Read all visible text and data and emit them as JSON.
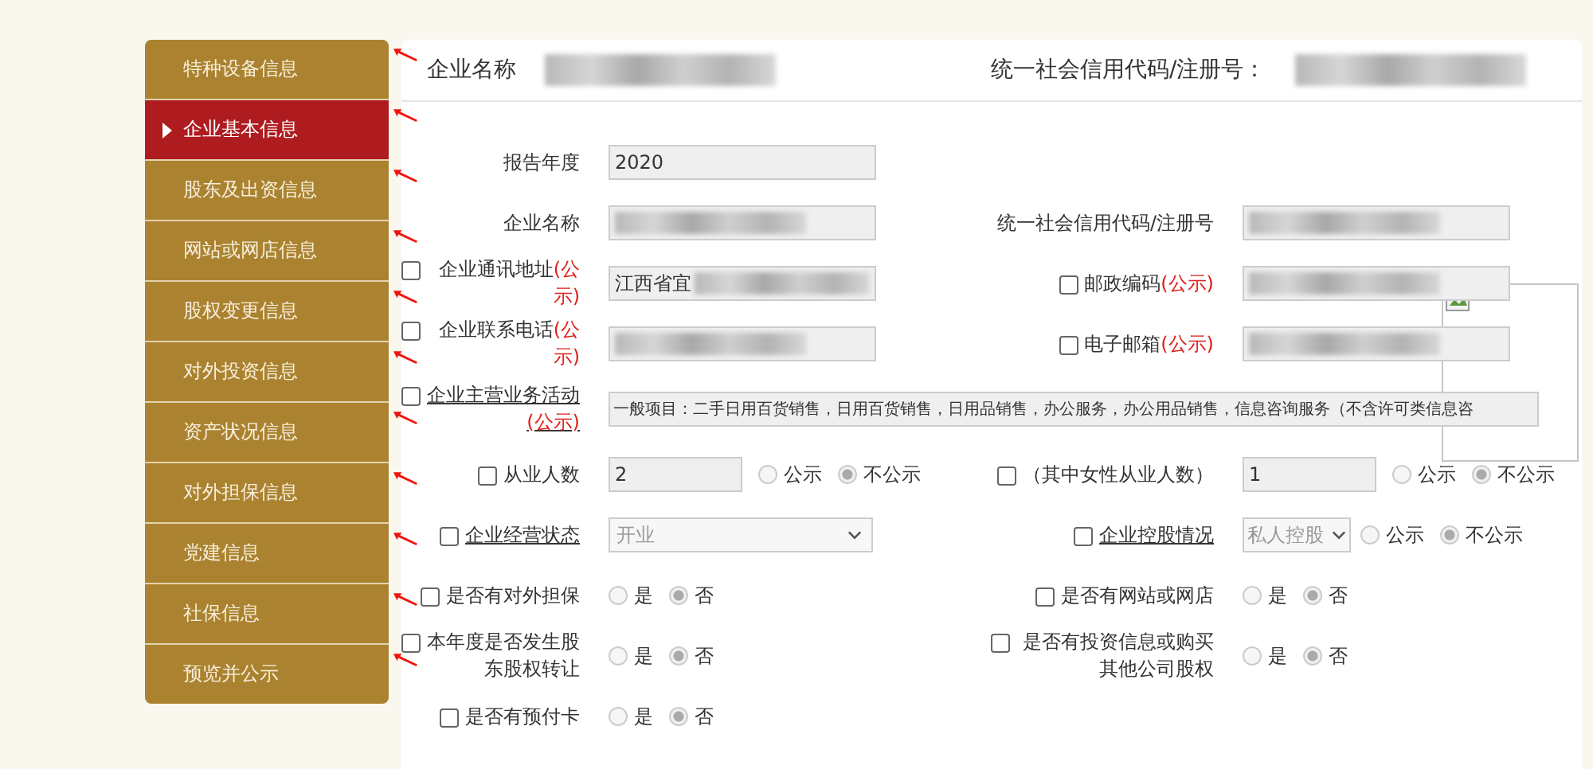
{
  "sidebar": {
    "items": [
      {
        "label": "特种设备信息",
        "selected": false,
        "annotated": true
      },
      {
        "label": "企业基本信息",
        "selected": true,
        "annotated": true
      },
      {
        "label": "股东及出资信息",
        "selected": false,
        "annotated": true
      },
      {
        "label": "网站或网店信息",
        "selected": false,
        "annotated": true
      },
      {
        "label": "股权变更信息",
        "selected": false,
        "annotated": true
      },
      {
        "label": "对外投资信息",
        "selected": false,
        "annotated": true
      },
      {
        "label": "资产状况信息",
        "selected": false,
        "annotated": true
      },
      {
        "label": "对外担保信息",
        "selected": false,
        "annotated": true
      },
      {
        "label": "党建信息",
        "selected": false,
        "annotated": true
      },
      {
        "label": "社保信息",
        "selected": false,
        "annotated": true
      },
      {
        "label": "预览并公示",
        "selected": false,
        "annotated": true
      }
    ]
  },
  "header": {
    "company_label": "企业名称",
    "code_label": "统一社会信用代码/注册号："
  },
  "form": {
    "rows": [
      {
        "fields": [
          {
            "label": "报告年度",
            "underlined": false,
            "control": {
              "kind": "input",
              "value": "2020"
            }
          }
        ]
      },
      {
        "fields": [
          {
            "label": "企业名称",
            "underlined": false,
            "control": {
              "kind": "input",
              "redacted": true
            }
          },
          {
            "label": "统一社会信用代码/注册号",
            "underlined": false,
            "control": {
              "kind": "input",
              "redacted": true
            }
          }
        ]
      },
      {
        "fields": [
          {
            "label": "企业通讯地址",
            "note": "(公示)",
            "checked": false,
            "underlined": false,
            "control": {
              "kind": "input",
              "value": "江西省宜",
              "redacted": true
            }
          },
          {
            "label": "邮政编码",
            "note": "(公示)",
            "checked": false,
            "underlined": false,
            "control": {
              "kind": "input",
              "redacted": true
            }
          }
        ]
      },
      {
        "fields": [
          {
            "label": "企业联系电话",
            "note": "(公示)",
            "checked": false,
            "underlined": false,
            "control": {
              "kind": "input",
              "redacted": true
            }
          },
          {
            "label": "电子邮箱",
            "note": "(公示)",
            "checked": false,
            "underlined": false,
            "control": {
              "kind": "input",
              "redacted": true
            }
          }
        ]
      },
      {
        "fields": [
          {
            "label": "企业主营业务活动",
            "note": "(公示)",
            "checked": false,
            "underlined": true,
            "control": {
              "kind": "wide",
              "value": "一般项目：二手日用百货销售，日用百货销售，日用品销售，办公服务，办公用品销售，信息咨询服务（不含许可类信息咨"
            }
          }
        ]
      },
      {
        "fields": [
          {
            "label": "从业人数",
            "checked": false,
            "underlined": false,
            "control": {
              "kind": "short",
              "value": "2"
            },
            "radios": [
              {
                "label": "公示",
                "selected": false
              },
              {
                "label": "不公示",
                "selected": true
              }
            ]
          },
          {
            "label": "（其中女性从业人数）",
            "checked": false,
            "underlined": false,
            "control": {
              "kind": "short",
              "value": "1"
            },
            "radios": [
              {
                "label": "公示",
                "selected": false
              },
              {
                "label": "不公示",
                "selected": true
              }
            ]
          }
        ]
      },
      {
        "fields": [
          {
            "label": "企业经营状态",
            "checked": false,
            "underlined": true,
            "control": {
              "kind": "select",
              "value": "开业"
            }
          },
          {
            "label": "企业控股情况",
            "checked": false,
            "underlined": true,
            "control": {
              "kind": "select-small",
              "value": "私人控股"
            },
            "radios": [
              {
                "label": "公示",
                "selected": false
              },
              {
                "label": "不公示",
                "selected": true
              }
            ]
          }
        ]
      },
      {
        "fields": [
          {
            "label": "是否有对外担保",
            "checked": false,
            "underlined": false,
            "radios": [
              {
                "label": "是",
                "selected": false
              },
              {
                "label": "否",
                "selected": true
              }
            ]
          },
          {
            "label": "是否有网站或网店",
            "checked": false,
            "underlined": false,
            "radios": [
              {
                "label": "是",
                "selected": false
              },
              {
                "label": "否",
                "selected": true
              }
            ]
          }
        ]
      },
      {
        "fields": [
          {
            "label": "本年度是否发生股东股权转让",
            "checked": false,
            "underlined": false,
            "radios": [
              {
                "label": "是",
                "selected": false
              },
              {
                "label": "否",
                "selected": true
              }
            ]
          },
          {
            "label": "是否有投资信息或购买其他公司股权",
            "checked": false,
            "underlined": false,
            "radios": [
              {
                "label": "是",
                "selected": false
              },
              {
                "label": "否",
                "selected": true
              }
            ]
          }
        ]
      },
      {
        "fields": [
          {
            "label": "是否有预付卡",
            "checked": false,
            "underlined": false,
            "radios": [
              {
                "label": "是",
                "selected": false
              },
              {
                "label": "否",
                "selected": true
              }
            ]
          }
        ]
      }
    ]
  }
}
